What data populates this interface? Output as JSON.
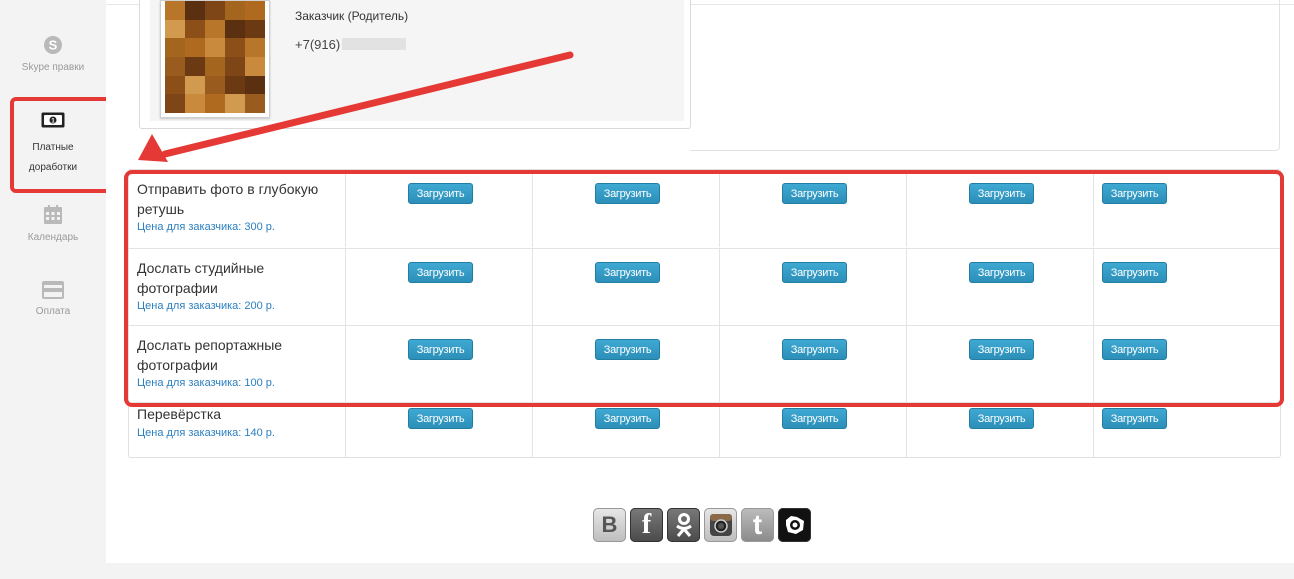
{
  "sidebar": {
    "items": [
      {
        "label": "Skype правки",
        "icon": "skype-icon"
      },
      {
        "label_line1": "Платные",
        "label_line2": "доработки",
        "icon": "money-icon"
      },
      {
        "label": "Календарь",
        "icon": "calendar-icon"
      },
      {
        "label": "Оплата",
        "icon": "credit-card-icon"
      }
    ]
  },
  "profile": {
    "role": "Заказчик (Родитель)",
    "phone_prefix": "+7(916)"
  },
  "tasks": [
    {
      "title": "Отправить фото в глубокую ретушь",
      "price": "Цена для заказчика: 300 р."
    },
    {
      "title": "Дослать студийные фотографии",
      "price": "Цена для заказчика: 200 р."
    },
    {
      "title": "Дослать репортажные фотографии",
      "price": "Цена для заказчика: 100 р."
    },
    {
      "title": "Перевёрстка",
      "price": "Цена для заказчика: 140 р."
    }
  ],
  "upload_label": "Загрузить",
  "social": [
    "vk-icon",
    "facebook-icon",
    "odnoklassniki-icon",
    "instagram-icon",
    "twitter-icon",
    "moymir-icon"
  ],
  "social_labels": {
    "vk": "B",
    "facebook": "f",
    "twitter": "t"
  },
  "colors": {
    "accent": "#2c8fb8",
    "highlight": "#e53935",
    "price": "#2a7fc1"
  }
}
